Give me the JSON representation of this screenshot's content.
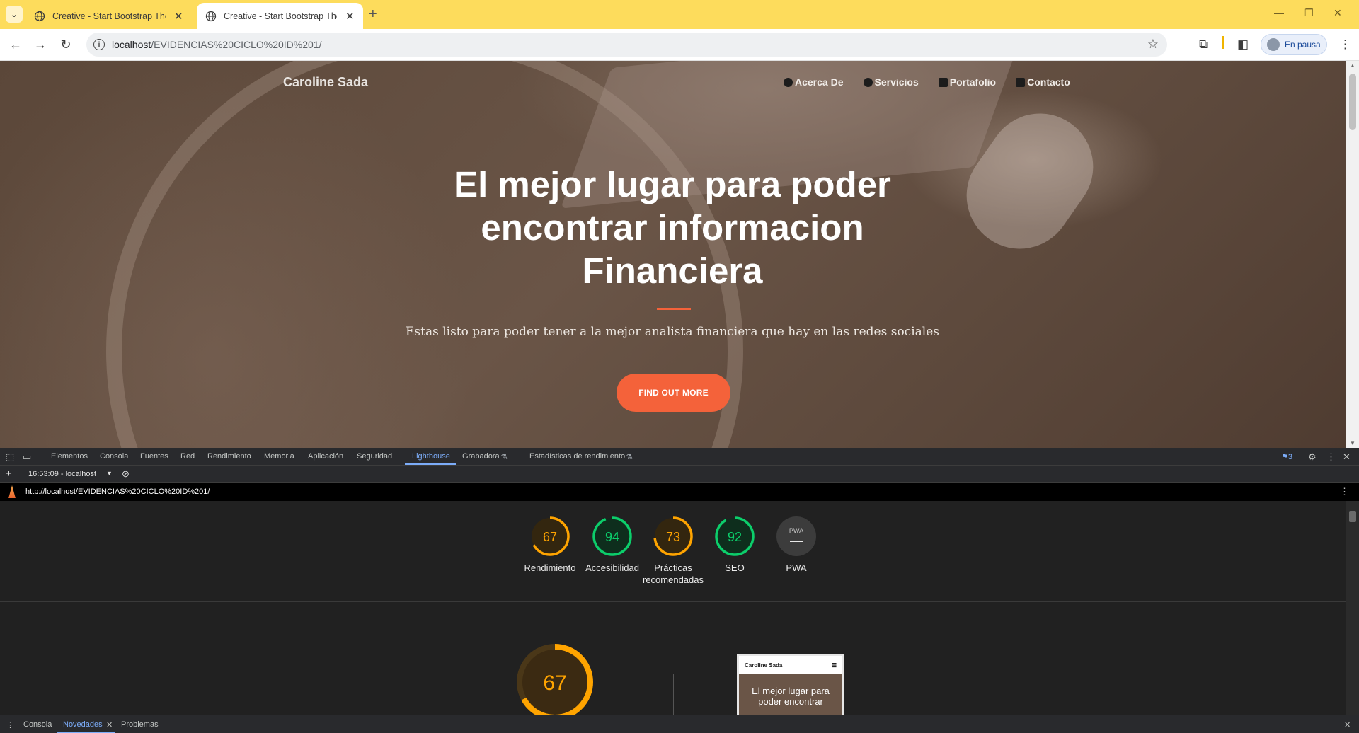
{
  "browser": {
    "tabs": [
      {
        "title": "Creative - Start Bootstrap Theme",
        "active": false
      },
      {
        "title": "Creative - Start Bootstrap Theme",
        "active": true
      }
    ],
    "url_host": "localhost",
    "url_path": "/EVIDENCIAS%20CICLO%20ID%201/",
    "profile_label": "En pausa",
    "theme_color": "#fddc5c"
  },
  "site": {
    "brand": "Caroline Sada",
    "nav": [
      {
        "label": "Acerca De",
        "icon": "user-circle-icon"
      },
      {
        "label": "Servicios",
        "icon": "info-circle-icon"
      },
      {
        "label": "Portafolio",
        "icon": "briefcase-icon"
      },
      {
        "label": "Contacto",
        "icon": "envelope-icon"
      }
    ],
    "hero_title": "El mejor lugar para poder encontrar informacion Financiera",
    "hero_subtitle": "Estas listo para poder tener a la mejor analista financiera que hay en las redes sociales",
    "cta_label": "FIND OUT MORE",
    "accent_color": "#f4623a"
  },
  "devtools": {
    "tabs": [
      "Elementos",
      "Consola",
      "Fuentes",
      "Red",
      "Rendimiento",
      "Memoria",
      "Aplicación",
      "Seguridad",
      "Lighthouse",
      "Grabadora",
      "Estadísticas de rendimiento"
    ],
    "active_tab": "Lighthouse",
    "issues_count": "3",
    "report_selector": "16:53:09 - localhost",
    "report_url": "http://localhost/EVIDENCIAS%20CICLO%20ID%201/",
    "scores": [
      {
        "label": "Rendimiento",
        "value": "67",
        "status": "average"
      },
      {
        "label": "Accesibilidad",
        "value": "94",
        "status": "pass"
      },
      {
        "label": "Prácticas recomendadas",
        "value": "73",
        "status": "average"
      },
      {
        "label": "SEO",
        "value": "92",
        "status": "pass"
      },
      {
        "label": "PWA",
        "value": "—",
        "status": "na"
      }
    ],
    "pwa_badge": "PWA",
    "main_score": "67",
    "thumbnail_brand": "Caroline Sada",
    "thumbnail_title": "El mejor lugar para poder encontrar",
    "colors": {
      "average": "#ffa400",
      "pass": "#0cce6b",
      "na": "#9aa0a6"
    },
    "drawer_tabs": [
      "Consola",
      "Novedades",
      "Problemas"
    ],
    "drawer_active": "Novedades"
  }
}
